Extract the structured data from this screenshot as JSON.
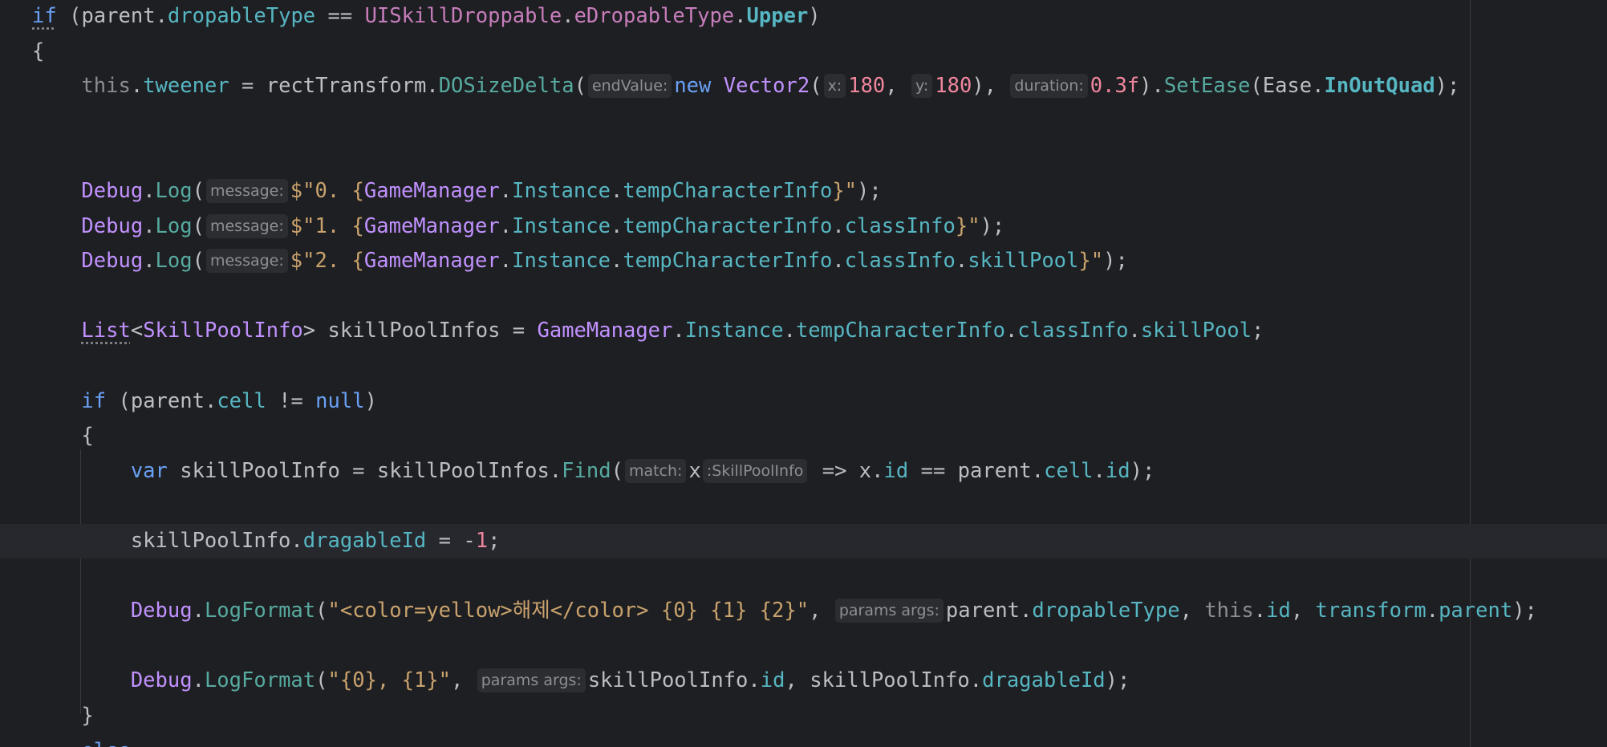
{
  "editor": {
    "language": "C#",
    "lines": [
      {
        "tokens": [
          {
            "t": "if",
            "c": "kwb ul"
          },
          {
            "t": " (",
            "c": "plain"
          },
          {
            "t": "parent",
            "c": "plain"
          },
          {
            "t": ".",
            "c": "plain"
          },
          {
            "t": "dropableType",
            "c": "fld"
          },
          {
            "t": " == ",
            "c": "plain"
          },
          {
            "t": "UISkillDroppable",
            "c": "cls"
          },
          {
            "t": ".",
            "c": "plain"
          },
          {
            "t": "eDropableType",
            "c": "cls"
          },
          {
            "t": ".",
            "c": "plain"
          },
          {
            "t": "Upper",
            "c": "fldb"
          },
          {
            "t": ")",
            "c": "plain"
          }
        ]
      },
      {
        "tokens": [
          {
            "t": "{",
            "c": "plain"
          }
        ]
      },
      {
        "tokens": [
          {
            "t": "    ",
            "c": "plain"
          },
          {
            "t": "this",
            "c": "kwg"
          },
          {
            "t": ".",
            "c": "plain"
          },
          {
            "t": "tweener",
            "c": "fld"
          },
          {
            "t": " = ",
            "c": "plain"
          },
          {
            "t": "rectTransform",
            "c": "plain"
          },
          {
            "t": ".",
            "c": "plain"
          },
          {
            "t": "DOSizeDelta",
            "c": "mthg"
          },
          {
            "t": "(",
            "c": "plain"
          },
          {
            "t": "endValue:",
            "c": "hint"
          },
          {
            "t": "new",
            "c": "kwb"
          },
          {
            "t": " ",
            "c": "plain"
          },
          {
            "t": "Vector2",
            "c": "typ"
          },
          {
            "t": "(",
            "c": "plain"
          },
          {
            "t": "x:",
            "c": "hint"
          },
          {
            "t": "180",
            "c": "num"
          },
          {
            "t": ", ",
            "c": "plain"
          },
          {
            "t": "y:",
            "c": "hint"
          },
          {
            "t": "180",
            "c": "num"
          },
          {
            "t": "), ",
            "c": "plain"
          },
          {
            "t": "duration:",
            "c": "hint"
          },
          {
            "t": "0.3f",
            "c": "num"
          },
          {
            "t": ").",
            "c": "plain"
          },
          {
            "t": "SetEase",
            "c": "mthg"
          },
          {
            "t": "(",
            "c": "plain"
          },
          {
            "t": "Ease",
            "c": "plain"
          },
          {
            "t": ".",
            "c": "plain"
          },
          {
            "t": "InOutQuad",
            "c": "fldb"
          },
          {
            "t": ");",
            "c": "plain"
          }
        ]
      },
      {
        "tokens": []
      },
      {
        "tokens": []
      },
      {
        "tokens": [
          {
            "t": "    ",
            "c": "plain"
          },
          {
            "t": "Debug",
            "c": "typ"
          },
          {
            "t": ".",
            "c": "plain"
          },
          {
            "t": "Log",
            "c": "mthg"
          },
          {
            "t": "(",
            "c": "plain"
          },
          {
            "t": "message:",
            "c": "hint"
          },
          {
            "t": "$\"0. {",
            "c": "str"
          },
          {
            "t": "GameManager",
            "c": "typ"
          },
          {
            "t": ".",
            "c": "plain"
          },
          {
            "t": "Instance",
            "c": "fld"
          },
          {
            "t": ".",
            "c": "plain"
          },
          {
            "t": "tempCharacterInfo",
            "c": "fld"
          },
          {
            "t": "}\"",
            "c": "str"
          },
          {
            "t": ");",
            "c": "plain"
          }
        ]
      },
      {
        "tokens": [
          {
            "t": "    ",
            "c": "plain"
          },
          {
            "t": "Debug",
            "c": "typ"
          },
          {
            "t": ".",
            "c": "plain"
          },
          {
            "t": "Log",
            "c": "mthg"
          },
          {
            "t": "(",
            "c": "plain"
          },
          {
            "t": "message:",
            "c": "hint"
          },
          {
            "t": "$\"1. {",
            "c": "str"
          },
          {
            "t": "GameManager",
            "c": "typ"
          },
          {
            "t": ".",
            "c": "plain"
          },
          {
            "t": "Instance",
            "c": "fld"
          },
          {
            "t": ".",
            "c": "plain"
          },
          {
            "t": "tempCharacterInfo",
            "c": "fld"
          },
          {
            "t": ".",
            "c": "plain"
          },
          {
            "t": "classInfo",
            "c": "fld"
          },
          {
            "t": "}\"",
            "c": "str"
          },
          {
            "t": ");",
            "c": "plain"
          }
        ]
      },
      {
        "tokens": [
          {
            "t": "    ",
            "c": "plain"
          },
          {
            "t": "Debug",
            "c": "typ"
          },
          {
            "t": ".",
            "c": "plain"
          },
          {
            "t": "Log",
            "c": "mthg"
          },
          {
            "t": "(",
            "c": "plain"
          },
          {
            "t": "message:",
            "c": "hint"
          },
          {
            "t": "$\"2. {",
            "c": "str"
          },
          {
            "t": "GameManager",
            "c": "typ"
          },
          {
            "t": ".",
            "c": "plain"
          },
          {
            "t": "Instance",
            "c": "fld"
          },
          {
            "t": ".",
            "c": "plain"
          },
          {
            "t": "tempCharacterInfo",
            "c": "fld"
          },
          {
            "t": ".",
            "c": "plain"
          },
          {
            "t": "classInfo",
            "c": "fld"
          },
          {
            "t": ".",
            "c": "plain"
          },
          {
            "t": "skillPool",
            "c": "fld"
          },
          {
            "t": "}\"",
            "c": "str"
          },
          {
            "t": ");",
            "c": "plain"
          }
        ]
      },
      {
        "tokens": []
      },
      {
        "tokens": [
          {
            "t": "    ",
            "c": "plain"
          },
          {
            "t": "List",
            "c": "typ ul"
          },
          {
            "t": "<",
            "c": "plain"
          },
          {
            "t": "SkillPoolInfo",
            "c": "typ"
          },
          {
            "t": "> skillPoolInfos = ",
            "c": "plain"
          },
          {
            "t": "GameManager",
            "c": "typ"
          },
          {
            "t": ".",
            "c": "plain"
          },
          {
            "t": "Instance",
            "c": "fld"
          },
          {
            "t": ".",
            "c": "plain"
          },
          {
            "t": "tempCharacterInfo",
            "c": "fld"
          },
          {
            "t": ".",
            "c": "plain"
          },
          {
            "t": "classInfo",
            "c": "fld"
          },
          {
            "t": ".",
            "c": "plain"
          },
          {
            "t": "skillPool",
            "c": "fld"
          },
          {
            "t": ";",
            "c": "plain"
          }
        ]
      },
      {
        "tokens": []
      },
      {
        "tokens": [
          {
            "t": "    ",
            "c": "plain"
          },
          {
            "t": "if",
            "c": "kwb"
          },
          {
            "t": " (parent.",
            "c": "plain"
          },
          {
            "t": "cell",
            "c": "fld"
          },
          {
            "t": " != ",
            "c": "plain"
          },
          {
            "t": "null",
            "c": "kwb"
          },
          {
            "t": ")",
            "c": "plain"
          }
        ]
      },
      {
        "tokens": [
          {
            "t": "    {",
            "c": "plain"
          }
        ]
      },
      {
        "tokens": [
          {
            "t": "        ",
            "c": "plain"
          },
          {
            "t": "var",
            "c": "kwb"
          },
          {
            "t": " skillPoolInfo = skillPoolInfos.",
            "c": "plain"
          },
          {
            "t": "Find",
            "c": "mthg"
          },
          {
            "t": "(",
            "c": "plain"
          },
          {
            "t": "match:",
            "c": "hint"
          },
          {
            "t": "x",
            "c": "plain"
          },
          {
            "t": ":SkillPoolInfo",
            "c": "hint"
          },
          {
            "t": " => x.",
            "c": "plain"
          },
          {
            "t": "id",
            "c": "fld"
          },
          {
            "t": " == parent.",
            "c": "plain"
          },
          {
            "t": "cell",
            "c": "fld"
          },
          {
            "t": ".",
            "c": "plain"
          },
          {
            "t": "id",
            "c": "fld"
          },
          {
            "t": ");",
            "c": "plain"
          }
        ]
      },
      {
        "tokens": []
      },
      {
        "tokens": [
          {
            "t": "        skillPoolInfo.",
            "c": "plain"
          },
          {
            "t": "dragableId",
            "c": "fld"
          },
          {
            "t": " = -",
            "c": "plain"
          },
          {
            "t": "1",
            "c": "num"
          },
          {
            "t": ";",
            "c": "plain"
          }
        ],
        "current": true
      },
      {
        "tokens": []
      },
      {
        "tokens": [
          {
            "t": "        ",
            "c": "plain"
          },
          {
            "t": "Debug",
            "c": "typ"
          },
          {
            "t": ".",
            "c": "plain"
          },
          {
            "t": "LogFormat",
            "c": "mthg"
          },
          {
            "t": "(",
            "c": "plain"
          },
          {
            "t": "\"<color=yellow>해제</color> {0} {1} {2}\"",
            "c": "str"
          },
          {
            "t": ", ",
            "c": "plain"
          },
          {
            "t": "params args:",
            "c": "hint"
          },
          {
            "t": "parent.",
            "c": "plain"
          },
          {
            "t": "dropableType",
            "c": "fld"
          },
          {
            "t": ", ",
            "c": "plain"
          },
          {
            "t": "this",
            "c": "kwg"
          },
          {
            "t": ".",
            "c": "plain"
          },
          {
            "t": "id",
            "c": "fld"
          },
          {
            "t": ", ",
            "c": "plain"
          },
          {
            "t": "transform",
            "c": "fld"
          },
          {
            "t": ".",
            "c": "plain"
          },
          {
            "t": "parent",
            "c": "fld"
          },
          {
            "t": ");",
            "c": "plain"
          }
        ]
      },
      {
        "tokens": []
      },
      {
        "tokens": [
          {
            "t": "        ",
            "c": "plain"
          },
          {
            "t": "Debug",
            "c": "typ"
          },
          {
            "t": ".",
            "c": "plain"
          },
          {
            "t": "LogFormat",
            "c": "mthg"
          },
          {
            "t": "(",
            "c": "plain"
          },
          {
            "t": "\"{0}, {1}\"",
            "c": "str"
          },
          {
            "t": ", ",
            "c": "plain"
          },
          {
            "t": "params args:",
            "c": "hint"
          },
          {
            "t": "skillPoolInfo.",
            "c": "plain"
          },
          {
            "t": "id",
            "c": "fld"
          },
          {
            "t": ", skillPoolInfo.",
            "c": "plain"
          },
          {
            "t": "dragableId",
            "c": "fld"
          },
          {
            "t": ");",
            "c": "plain"
          }
        ]
      },
      {
        "tokens": [
          {
            "t": "    }",
            "c": "plain"
          }
        ]
      },
      {
        "tokens": [
          {
            "t": "    else",
            "c": "kwb"
          }
        ]
      }
    ]
  }
}
